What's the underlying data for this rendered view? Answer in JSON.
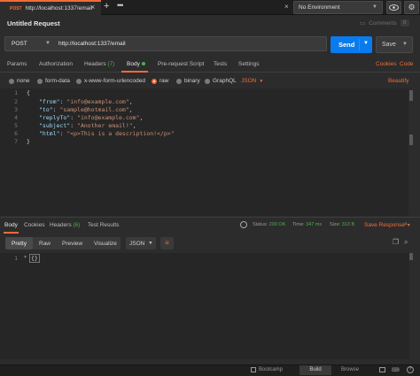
{
  "tab": {
    "method": "POST",
    "url": "http://localhost:1337/email"
  },
  "environment": {
    "selected": "No Environment"
  },
  "request": {
    "title": "Untitled Request",
    "comments_label": "Comments",
    "comments_count": "0",
    "method": "POST",
    "url": "http://localhost:1337/email",
    "send_label": "Send",
    "save_label": "Save"
  },
  "request_tabs": {
    "params": "Params",
    "authorization": "Authorization",
    "headers": "Headers",
    "headers_count": "(7)",
    "body": "Body",
    "prerequest": "Pre-request Script",
    "tests": "Tests",
    "settings": "Settings",
    "cookies": "Cookies",
    "code": "Code"
  },
  "body_types": {
    "none": "none",
    "form_data": "form-data",
    "urlencoded": "x-www-form-urlencoded",
    "raw": "raw",
    "binary": "binary",
    "graphql": "GraphQL",
    "format": "JSON",
    "beautify": "Beautify"
  },
  "editor": {
    "line_numbers": [
      "1",
      "2",
      "3",
      "4",
      "5",
      "6",
      "7"
    ],
    "lines": [
      {
        "key": "",
        "value": "",
        "open": "{"
      },
      {
        "key": "\"from\"",
        "value": "\"info@example.com\""
      },
      {
        "key": "\"to\"",
        "value": "\"sample@hotmail.com\""
      },
      {
        "key": "\"replyTo\"",
        "value": "\"info@example.com\""
      },
      {
        "key": "\"subject\"",
        "value": "\"Another email!\""
      },
      {
        "key": "\"html\"",
        "value": "\"<p>This is a description!</p>\""
      },
      {
        "key": "",
        "value": "",
        "open": "}"
      }
    ]
  },
  "response_tabs": {
    "body": "Body",
    "cookies": "Cookies",
    "headers": "Headers",
    "headers_count": "(6)",
    "test_results": "Test Results"
  },
  "response_status": {
    "status_label": "Status:",
    "status_value": "200 OK",
    "time_label": "Time:",
    "time_value": "347 ms",
    "size_label": "Size:",
    "size_value": "313 B",
    "save_response": "Save Response"
  },
  "response_view": {
    "pretty": "Pretty",
    "raw": "Raw",
    "preview": "Preview",
    "visualize": "Visualize",
    "format": "JSON",
    "line_number": "1",
    "content": "{}"
  },
  "statusbar": {
    "bootcamp": "Bootcamp",
    "build": "Build",
    "browse": "Browse"
  },
  "colors": {
    "accent": "#f26b3a",
    "send": "#097bed",
    "status_ok": "#4bb04b"
  }
}
